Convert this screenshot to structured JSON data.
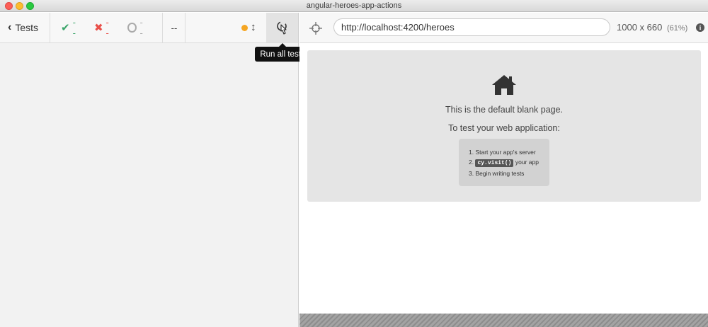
{
  "window": {
    "title": "angular-heroes-app-actions"
  },
  "reporter": {
    "tests_label": "Tests",
    "stats": {
      "passed": "--",
      "failed": "--",
      "pending": "--"
    },
    "duration": "--",
    "run_all_tooltip": "Run all tests"
  },
  "aut": {
    "url": "http://localhost:4200/heroes",
    "viewport": {
      "size": "1000 x 660",
      "scale": "(61%)"
    },
    "blank_page": {
      "message": "This is the default blank page.",
      "instruction": "To test your web application:",
      "steps": {
        "step1": "Start your app's server",
        "step2_code": "cy.visit()",
        "step2_text": "your app",
        "step3": "Begin writing tests"
      }
    }
  },
  "colors": {
    "passed": "#3ba56a",
    "failed": "#e94f49",
    "indicator": "#f5a623"
  },
  "icons": [
    "chevron-left-icon",
    "check-icon",
    "cross-icon",
    "circle-icon",
    "resize-icon",
    "run-all-icon",
    "crosshair-icon",
    "info-icon",
    "home-icon"
  ]
}
